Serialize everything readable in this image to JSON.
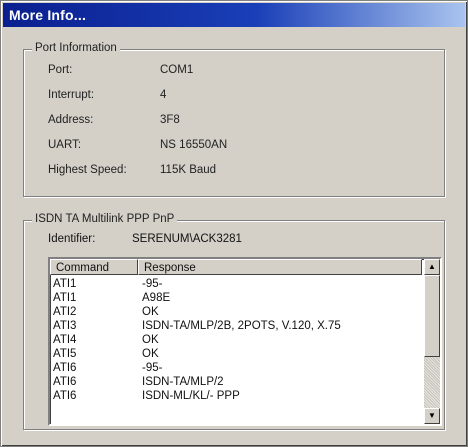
{
  "window": {
    "title": "More Info..."
  },
  "port_info": {
    "legend": "Port Information",
    "rows": [
      {
        "label": "Port:",
        "value": "COM1"
      },
      {
        "label": "Interrupt:",
        "value": "4"
      },
      {
        "label": "Address:",
        "value": "3F8"
      },
      {
        "label": "UART:",
        "value": "NS 16550AN"
      },
      {
        "label": "Highest Speed:",
        "value": "115K Baud"
      }
    ]
  },
  "isdn": {
    "legend": "ISDN TA Multilink PPP PnP",
    "identifier_label": "Identifier:",
    "identifier_value": "SERENUM\\ACK3281",
    "list": {
      "headers": [
        "Command",
        "Response"
      ],
      "rows": [
        [
          "ATI1",
          "-95-"
        ],
        [
          "ATI1",
          "A98E"
        ],
        [
          "ATI2",
          "OK"
        ],
        [
          "ATI3",
          "ISDN-TA/MLP/2B, 2POTS, V.120, X.75"
        ],
        [
          "ATI4",
          "OK"
        ],
        [
          "ATI5",
          "OK"
        ],
        [
          "ATI6",
          "-95-"
        ],
        [
          "ATI6",
          "ISDN-TA/MLP/2"
        ],
        [
          "ATI6",
          "ISDN-ML/KL/- PPP"
        ]
      ]
    },
    "scrollbar": {
      "up_icon": "▲",
      "down_icon": "▼"
    }
  }
}
